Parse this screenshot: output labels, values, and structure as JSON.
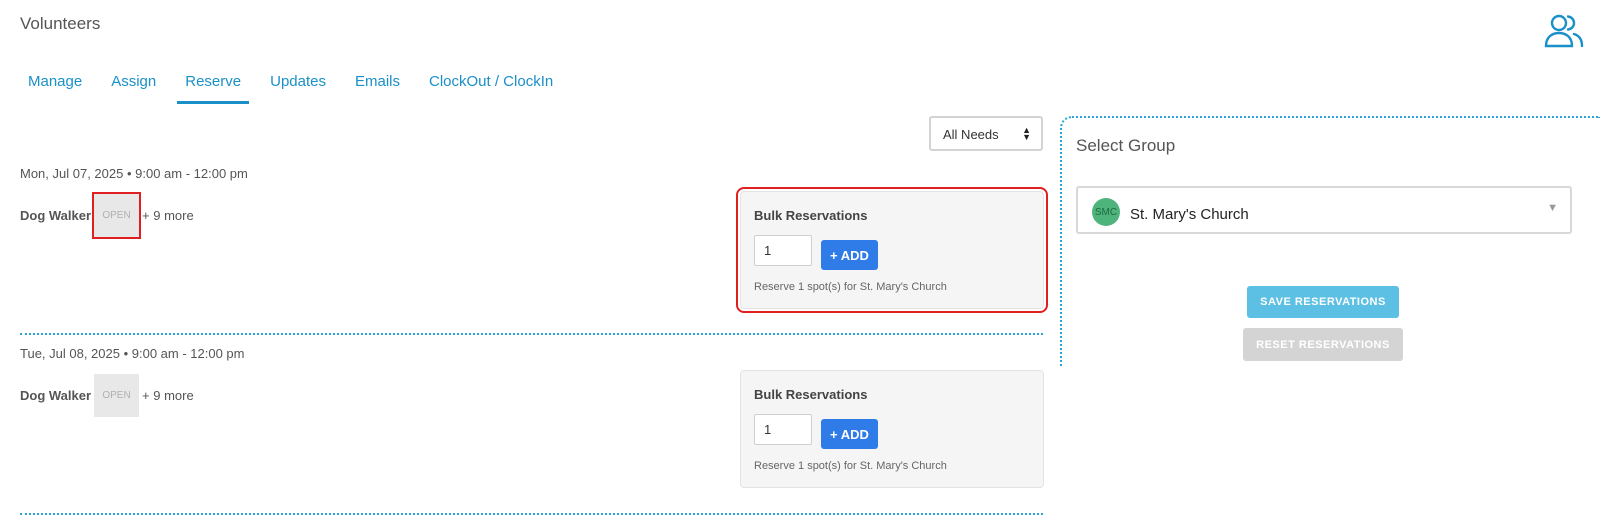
{
  "app": {
    "title": "Volunteers",
    "icon": "users-icon"
  },
  "tabs": [
    {
      "label": "Manage",
      "active": false
    },
    {
      "label": "Assign",
      "active": false
    },
    {
      "label": "Reserve",
      "active": true
    },
    {
      "label": "Updates",
      "active": false
    },
    {
      "label": "Emails",
      "active": false
    },
    {
      "label": "ClockOut / ClockIn",
      "active": false
    }
  ],
  "filter": {
    "selected": "All Needs"
  },
  "slots": [
    {
      "date": "Mon, Jul 07, 2025 • 9:00 am - 12:00 pm",
      "need": "Dog Walker",
      "status": "OPEN",
      "more": "+ 9 more",
      "bulk": {
        "title": "Bulk Reservations",
        "quantity": "1",
        "add_label": "+ ADD",
        "note": "Reserve 1 spot(s) for St. Mary's Church"
      }
    },
    {
      "date": "Tue, Jul 08, 2025 • 9:00 am - 12:00 pm",
      "need": "Dog Walker",
      "status": "OPEN",
      "more": "+ 9 more",
      "bulk": {
        "title": "Bulk Reservations",
        "quantity": "1",
        "add_label": "+ ADD",
        "note": "Reserve 1 spot(s) for St. Mary's Church"
      }
    }
  ],
  "group": {
    "title": "Select Group",
    "selected": {
      "initials": "SMC",
      "name": "St. Mary's Church"
    }
  },
  "actions": {
    "save_label": "SAVE RESERVATIONS",
    "reset_label": "RESET RESERVATIONS"
  },
  "colors": {
    "accent": "#1a90c8",
    "add_button": "#2f7be7",
    "save_button": "#5bc0e3",
    "highlight": "#e02020"
  }
}
